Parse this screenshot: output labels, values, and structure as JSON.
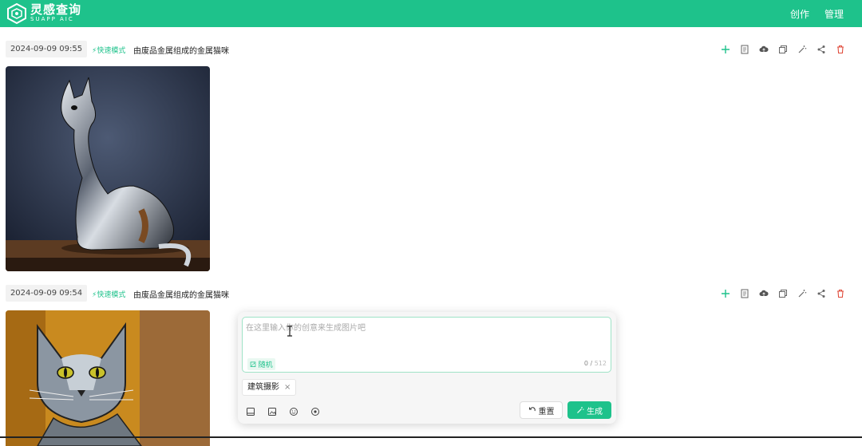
{
  "colors": {
    "brand": "#1ec28b",
    "delete": "#e04c3c"
  },
  "header": {
    "logo_icon": "hexagon-logo-icon",
    "brand_title": "灵感查询",
    "brand_subtitle": "SUAPP AIC",
    "nav": [
      {
        "label": "创作"
      },
      {
        "label": "管理"
      }
    ]
  },
  "records": [
    {
      "datetime": "2024-09-09 09:55",
      "mode": "⚡快速模式",
      "prompt": "由废品金属组成的金属猫咪",
      "actions": [
        "plus-icon",
        "copy-doc-icon",
        "cloud-upload-icon",
        "duplicate-icon",
        "magic-wand-icon",
        "share-icon",
        "trash-icon"
      ],
      "image": "metal-cat-image"
    },
    {
      "datetime": "2024-09-09 09:54",
      "mode": "⚡快速模式",
      "prompt": "由废品金属组成的金属猫咪",
      "actions": [
        "plus-icon",
        "copy-doc-icon",
        "cloud-upload-icon",
        "duplicate-icon",
        "magic-wand-icon",
        "share-icon",
        "trash-icon"
      ],
      "image": "metal-cat-portrait-image"
    }
  ],
  "composer": {
    "placeholder": "在这里输入你的创意来生成图片吧",
    "dice_label": "⚂ 随机",
    "counter_current": "0 /",
    "counter_max": "512",
    "style_tag": "建筑摄影",
    "tools": [
      "image-icon",
      "image-upload-icon",
      "emoji-icon",
      "eye-icon"
    ],
    "reset_label": "重置",
    "generate_label": "生成"
  }
}
